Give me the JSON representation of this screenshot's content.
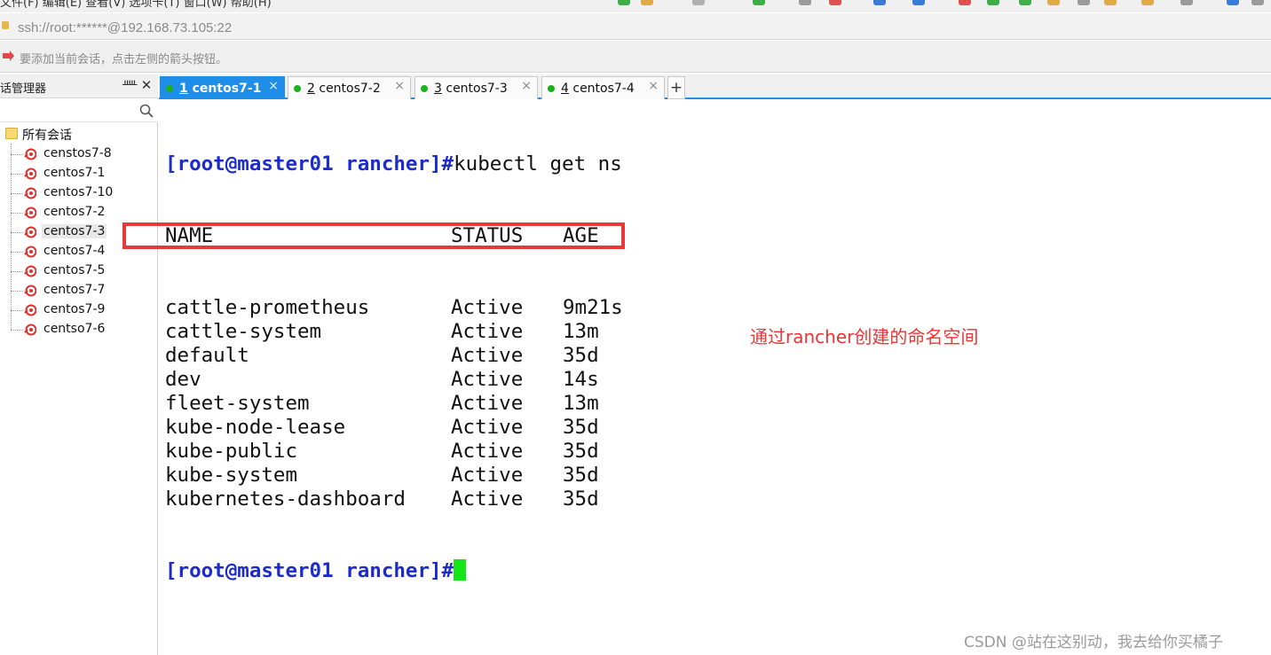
{
  "menubar": {
    "text": "文件(F)   编辑(E)   查看(V)   选项卡(T)   窗口(W)   帮助(H)"
  },
  "addressbar": {
    "value": "ssh://root:******@192.168.73.105:22"
  },
  "hint": {
    "text": "要添加当前会话，点击左侧的箭头按钮。"
  },
  "session_panel": {
    "title": "话管理器",
    "pin": "ᚊ",
    "close": "✕",
    "root_label": "所有会话",
    "items": [
      "censtos7-8",
      "centos7-1",
      "centos7-10",
      "centos7-2",
      "centos7-3",
      "centos7-4",
      "centos7-5",
      "centos7-7",
      "centos7-9",
      "centso7-6"
    ],
    "selected": "centos7-3"
  },
  "tabs": [
    {
      "num": "1",
      "name": " centos7-1",
      "active": true
    },
    {
      "num": "2",
      "name": " centos7-2",
      "active": false
    },
    {
      "num": "3",
      "name": " centos7-3",
      "active": false
    },
    {
      "num": "4",
      "name": " centos7-4",
      "active": false
    }
  ],
  "tab_close": "×",
  "add_tab": "+",
  "terminal": {
    "prompt": "[root@master01 rancher]#",
    "command": "kubectl get ns",
    "headers": [
      "NAME",
      "STATUS",
      "AGE"
    ],
    "rows": [
      [
        "cattle-prometheus",
        "Active",
        "9m21s"
      ],
      [
        "cattle-system",
        "Active",
        "13m"
      ],
      [
        "default",
        "Active",
        "35d"
      ],
      [
        "dev",
        "Active",
        "14s"
      ],
      [
        "fleet-system",
        "Active",
        "13m"
      ],
      [
        "kube-node-lease",
        "Active",
        "35d"
      ],
      [
        "kube-public",
        "Active",
        "35d"
      ],
      [
        "kube-system",
        "Active",
        "35d"
      ],
      [
        "kubernetes-dashboard",
        "Active",
        "35d"
      ]
    ],
    "final_prompt": "[root@master01 rancher]#"
  },
  "annotation": "通过rancher创建的命名空间",
  "watermark": "CSDN @站在这别动，我去给你买橘子",
  "colors": {
    "accent": "#1f8ee8",
    "prompt": "#1c2bc9",
    "cursor": "#16e616",
    "highlight": "#e8393a",
    "status_dot": "#1bb31b"
  }
}
